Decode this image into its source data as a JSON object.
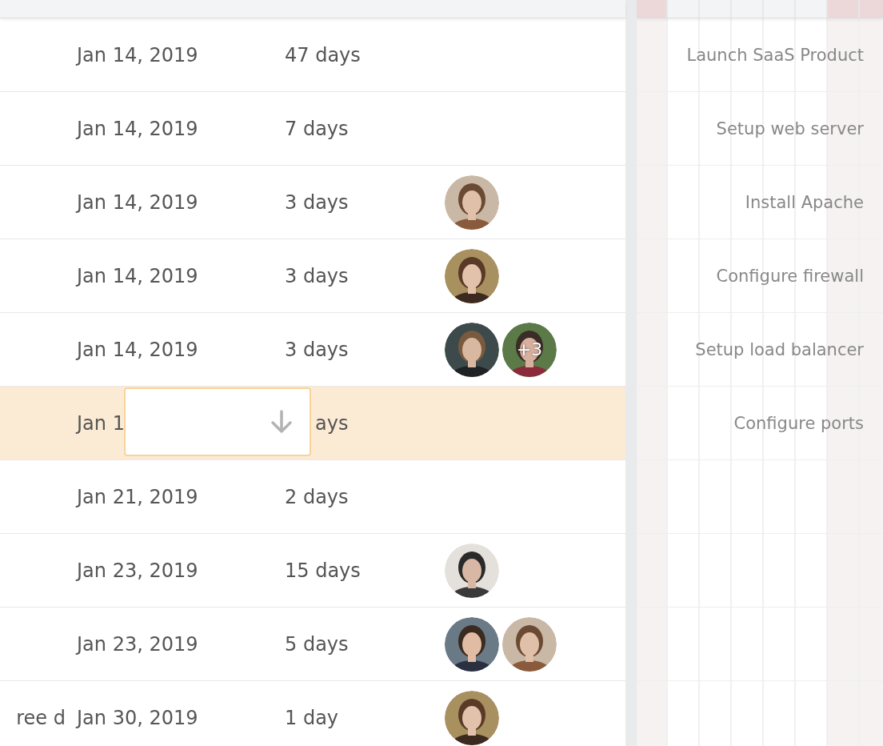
{
  "timeline": {
    "days": [
      {
        "weekend": true
      },
      {
        "weekend": false
      },
      {
        "weekend": false
      },
      {
        "weekend": false
      },
      {
        "weekend": false
      },
      {
        "weekend": false
      },
      {
        "weekend": true
      },
      {
        "weekend": true
      }
    ]
  },
  "rows": [
    {
      "name": "",
      "start": "Jan 14, 2019",
      "duration": "47 days",
      "assignees": [],
      "label": "Launch SaaS Product",
      "selected": false,
      "editing": false
    },
    {
      "name": "",
      "start": "Jan 14, 2019",
      "duration": "7 days",
      "assignees": [],
      "label": "Setup web server",
      "selected": false,
      "editing": false
    },
    {
      "name": "",
      "start": "Jan 14, 2019",
      "duration": "3 days",
      "assignees": [
        {
          "kind": "picture"
        }
      ],
      "label": "Install Apache",
      "selected": false,
      "editing": false
    },
    {
      "name": "",
      "start": "Jan 14, 2019",
      "duration": "3 days",
      "assignees": [
        {
          "kind": "picture"
        }
      ],
      "label": "Configure firewall",
      "selected": false,
      "editing": false
    },
    {
      "name": "",
      "start": "Jan 14, 2019",
      "duration": "3 days",
      "assignees": [
        {
          "kind": "picture"
        },
        {
          "kind": "picture",
          "more": "+3"
        }
      ],
      "label": "Setup load balancer",
      "selected": false,
      "editing": false
    },
    {
      "name": "",
      "start": "Jan 1",
      "duration": "ays",
      "assignees": [],
      "label": "Configure ports",
      "selected": true,
      "editing": true
    },
    {
      "name": "",
      "start": "Jan 21, 2019",
      "duration": "2 days",
      "assignees": [],
      "label": "",
      "selected": false,
      "editing": false
    },
    {
      "name": "",
      "start": "Jan 23, 2019",
      "duration": "15 days",
      "assignees": [
        {
          "kind": "picture"
        }
      ],
      "label": "",
      "selected": false,
      "editing": false
    },
    {
      "name": "",
      "start": "Jan 23, 2019",
      "duration": "5 days",
      "assignees": [
        {
          "kind": "picture"
        },
        {
          "kind": "picture"
        }
      ],
      "label": "",
      "selected": false,
      "editing": false
    },
    {
      "name": "ree d",
      "start": "Jan 30, 2019",
      "duration": "1 day",
      "assignees": [
        {
          "kind": "picture"
        }
      ],
      "label": "",
      "selected": false,
      "editing": false
    }
  ]
}
